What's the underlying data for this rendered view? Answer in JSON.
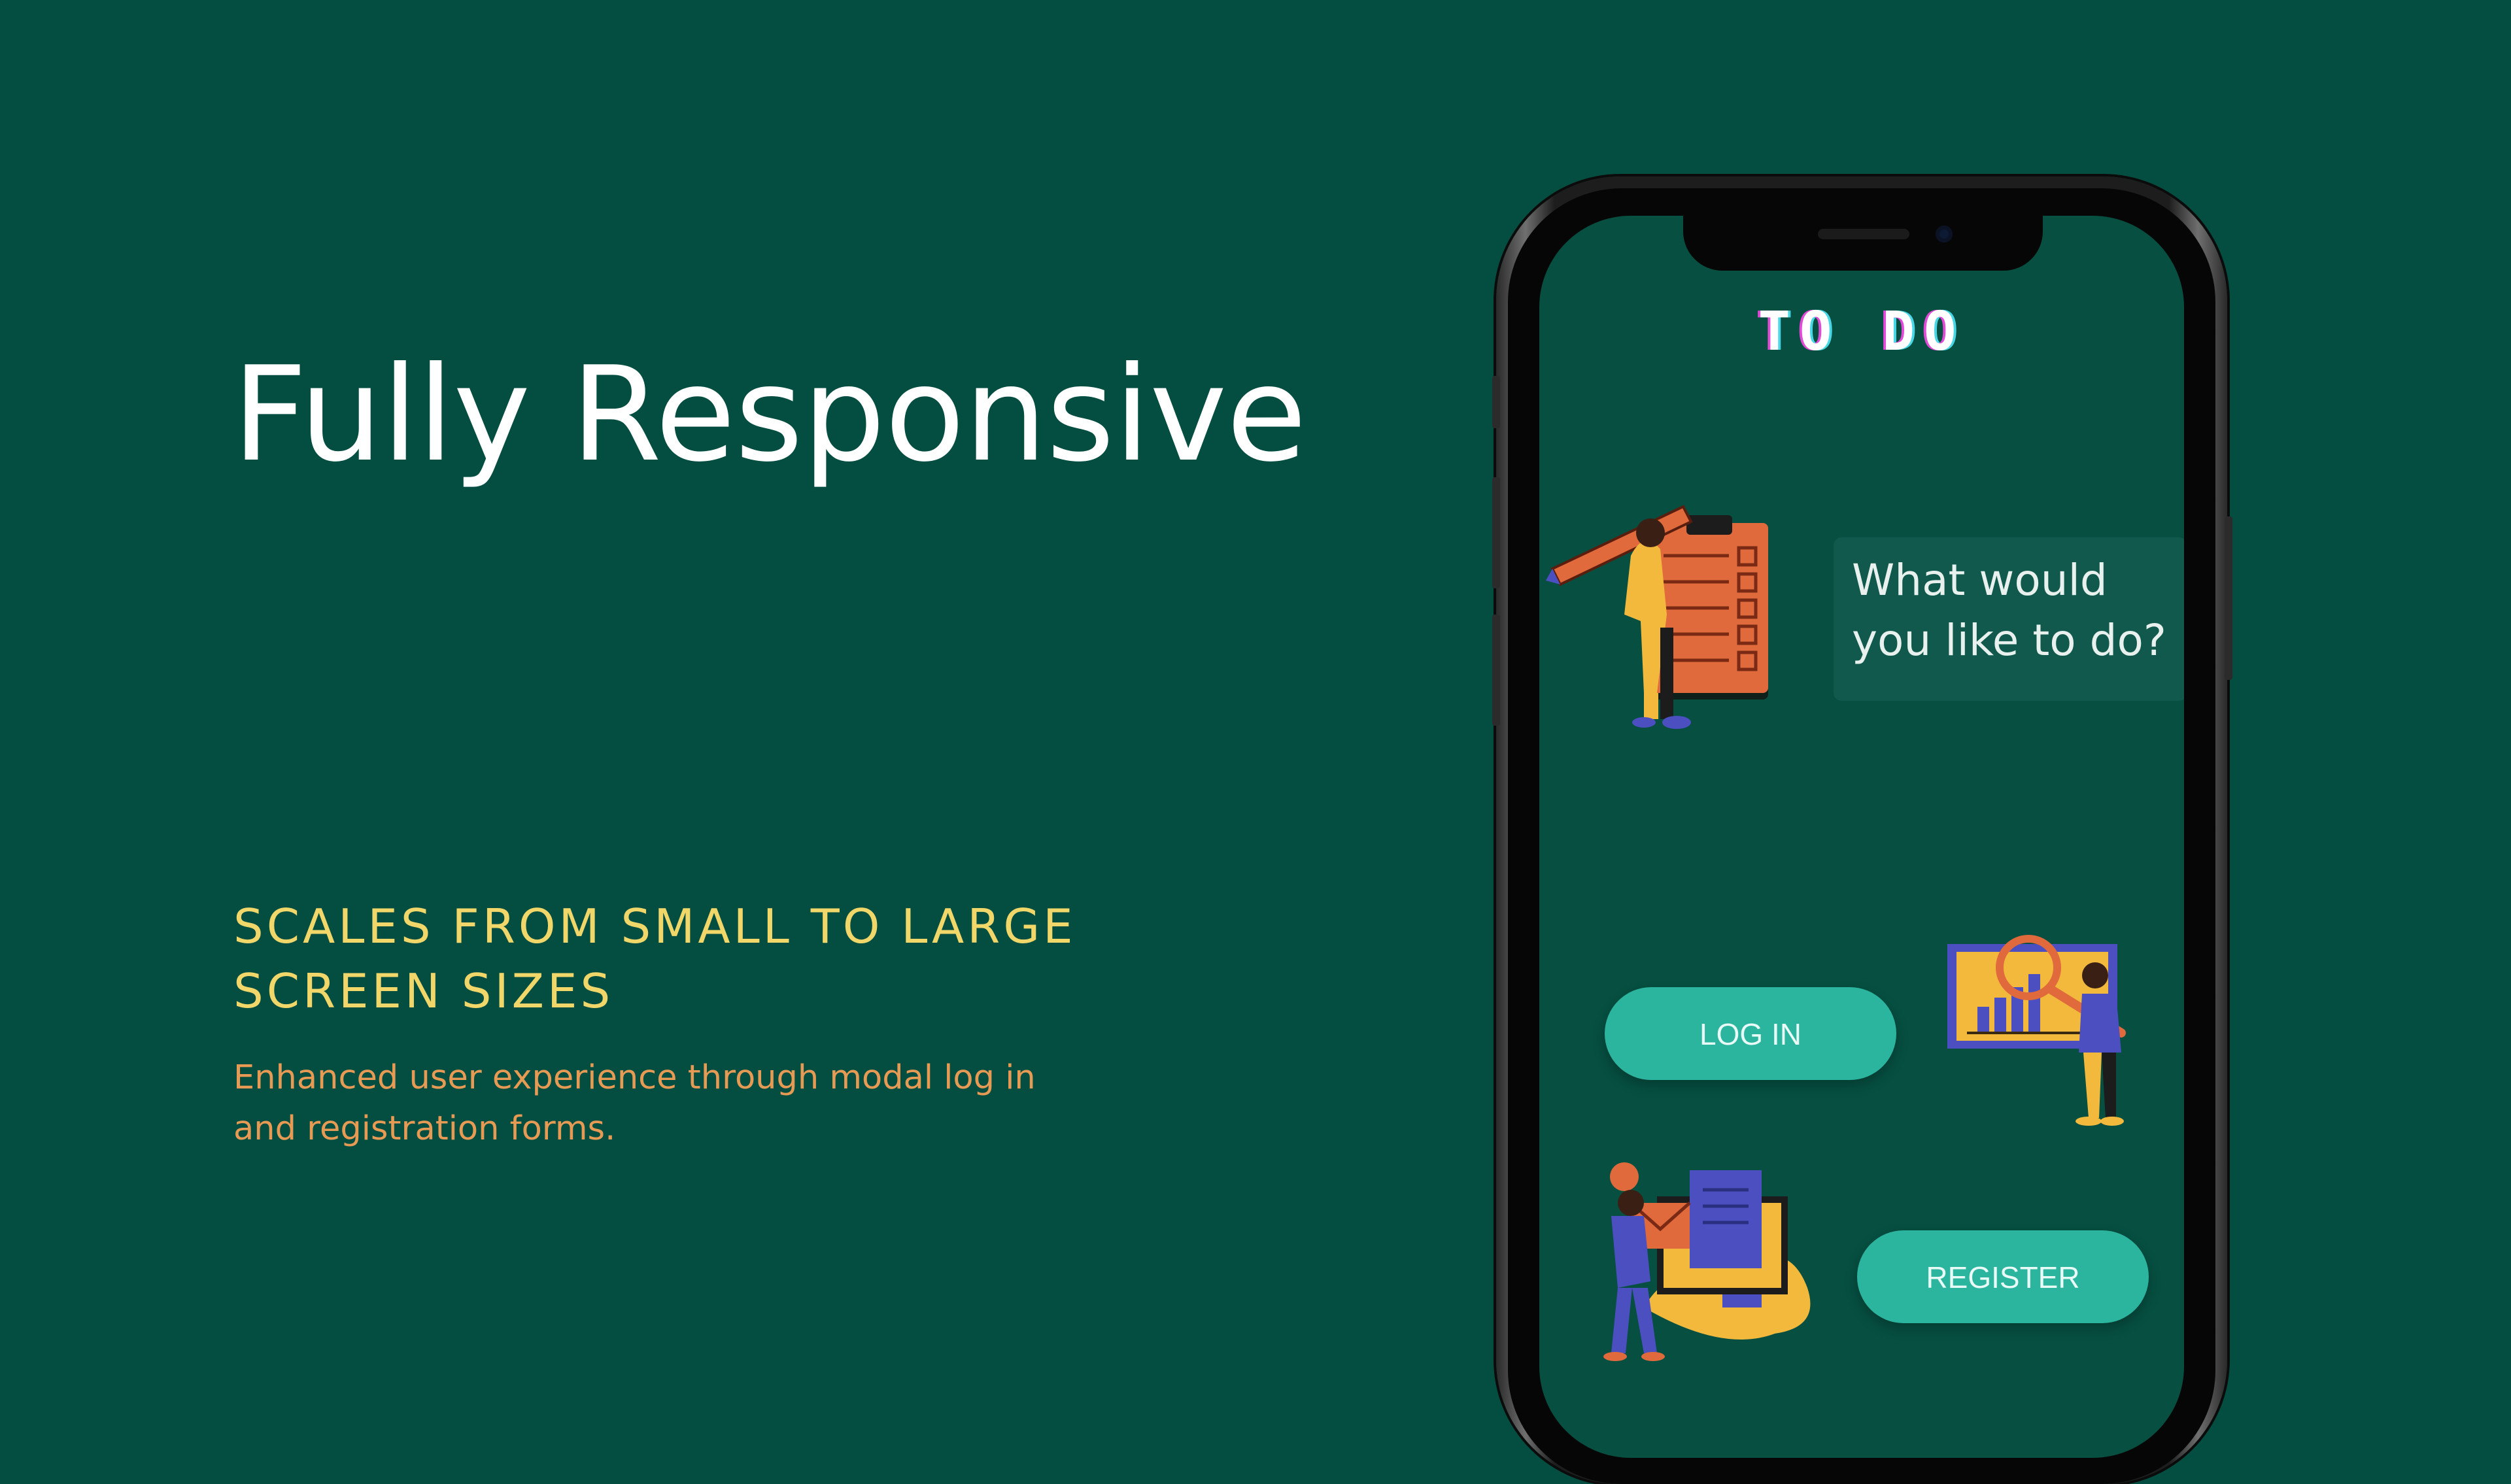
{
  "slide": {
    "title": "Fully Responsive",
    "subtitle_lines": [
      "SCALES FROM SMALL TO LARGE",
      "SCREEN SIZES"
    ],
    "description_lines": [
      "Enhanced user experience through modal log in",
      "and registration forms."
    ]
  },
  "phone_app": {
    "title": "TO DO",
    "question_lines": [
      "What would",
      "you like to do?"
    ],
    "login_label": "LOG IN",
    "register_label": "REGISTER"
  },
  "colors": {
    "background": "#034e40",
    "subtitle": "#f1d769",
    "description": "#e69a54",
    "button": "#2bb59f"
  },
  "icons": [
    "clipboard-pencil-illustration",
    "chart-analysis-illustration",
    "document-envelope-illustration"
  ]
}
